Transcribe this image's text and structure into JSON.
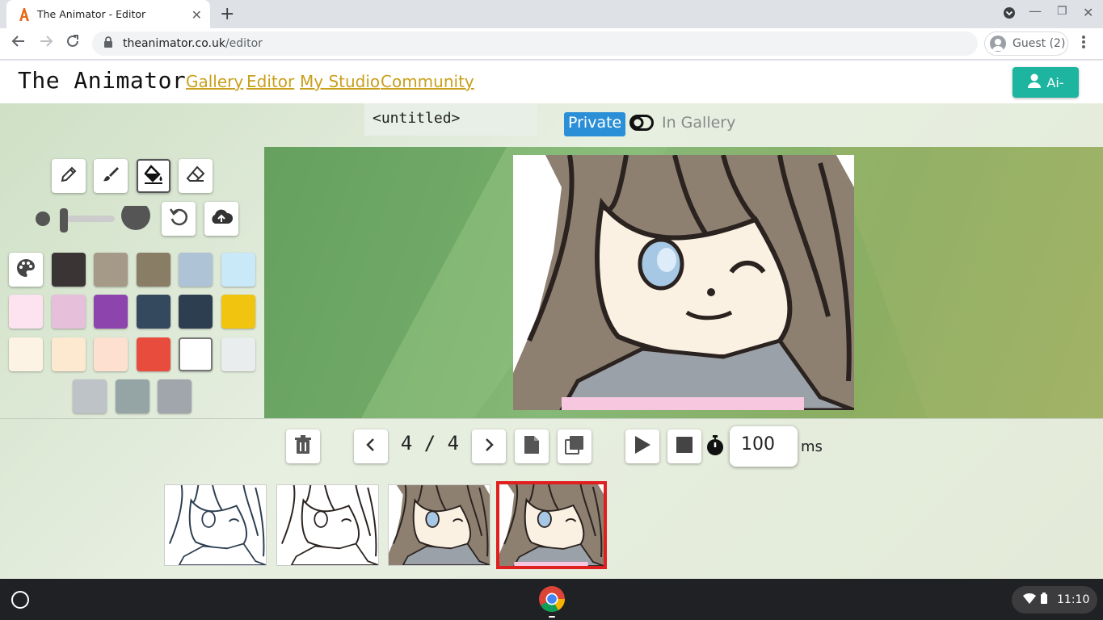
{
  "browser": {
    "tab_title": "The Animator - Editor",
    "url_host": "theanimator.co.uk",
    "url_path": "/editor",
    "profile": "Guest (2)"
  },
  "site": {
    "logo": "The Animator",
    "nav": [
      "Gallery",
      "Editor",
      "My Studio",
      "Community"
    ],
    "user_button": "Ai-"
  },
  "editor": {
    "title": "<untitled>",
    "visibility_private": "Private",
    "visibility_gallery": "In Gallery",
    "frame_counter": "4 / 4",
    "frame_delay": "100",
    "frame_delay_unit": "ms",
    "selected_frame": 4,
    "frame_count": 4
  },
  "tools": [
    "pencil-icon",
    "brush-icon",
    "fill-bucket-icon",
    "eraser-icon"
  ],
  "selected_tool": "fill-bucket-icon",
  "palette": {
    "colors": [
      "#3a3434",
      "#a59a87",
      "#8a7d66",
      "#aec3d6",
      "#c9e8f8",
      "#fde3f0",
      "#e6bfdb",
      "#8e44ad",
      "#34495e",
      "#2c3e50",
      "#f1c40f",
      "#fdf3e4",
      "#fde9d0",
      "#fde0d0",
      "#e74c3c",
      "#ffffff",
      "#eaeded",
      "#bdc3c7",
      "#95a5a6",
      "#a0a6ab"
    ],
    "selected_color": "#ffffff"
  },
  "system": {
    "time": "11:10"
  }
}
